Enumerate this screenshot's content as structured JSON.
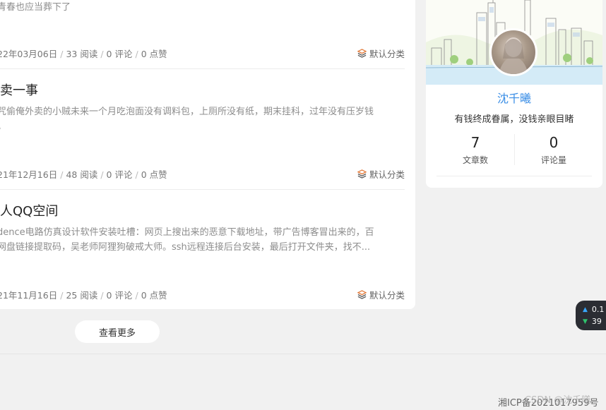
{
  "posts": [
    {
      "excerpt": "青春也应当葬下了",
      "date": "22年03月06日",
      "views": "33 阅读",
      "comments": "0 评论",
      "likes": "0 点赞",
      "category": "默认分类"
    },
    {
      "title": "卖一事",
      "excerpt_lines": [
        "咒偷俺外卖的小贼未来一个月吃泡面没有调料包，上厕所没有纸，期末挂科，过年没有压岁钱",
        "。"
      ],
      "date": "21年12月16日",
      "views": "48 阅读",
      "comments": "0 评论",
      "likes": "0 点赞",
      "category": "默认分类"
    },
    {
      "title": "人QQ空间",
      "excerpt_lines": [
        "dence电路仿真设计软件安装吐槽：网页上搜出来的恶意下载地址，带广告博客冒出来的，百",
        "网盘链接提取码，吴老师阿狸狗破戒大师。ssh远程连接后台安装，最后打开文件夹，找不..."
      ],
      "date": "21年11月16日",
      "views": "25 阅读",
      "comments": "0 评论",
      "likes": "0 点赞",
      "category": "默认分类"
    }
  ],
  "more_label": "查看更多",
  "profile": {
    "name": "沈千曦",
    "motto": "有钱终成眷属，没钱亲眼目睹",
    "stats": [
      {
        "value": "7",
        "label": "文章数"
      },
      {
        "value": "0",
        "label": "评论量"
      }
    ]
  },
  "speed": {
    "up": "0.1",
    "down": "39"
  },
  "footer": {
    "icp": "湘ICP备2021017959号",
    "watermark": "CSDN @沈千曦"
  },
  "icons": {
    "category": "layers-icon",
    "up": "arrow-up-icon",
    "down": "arrow-down-icon"
  },
  "colors": {
    "accent": "#3a8ee6",
    "category_icon": "#e27a3a"
  }
}
